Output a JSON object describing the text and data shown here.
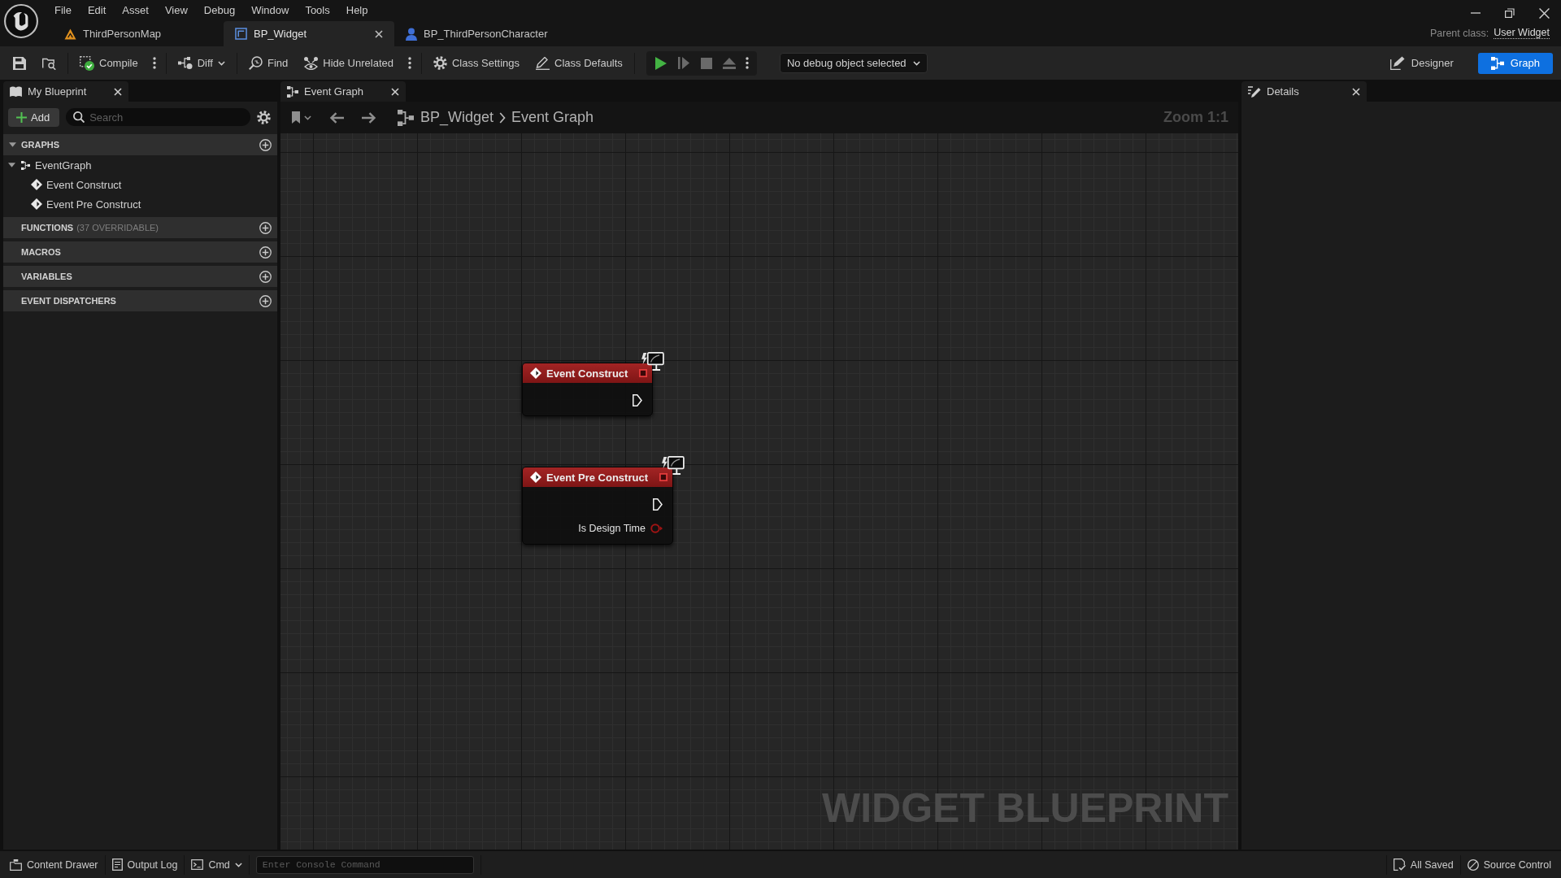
{
  "window": {
    "menu": [
      "File",
      "Edit",
      "Asset",
      "View",
      "Debug",
      "Window",
      "Tools",
      "Help"
    ],
    "parent_class_label": "Parent class:",
    "parent_class": "User Widget"
  },
  "document_tabs": [
    {
      "kind": "level",
      "label": "ThirdPersonMap",
      "selected": false
    },
    {
      "kind": "widget",
      "label": "BP_Widget",
      "selected": true
    },
    {
      "kind": "character",
      "label": "BP_ThirdPersonCharacter",
      "selected": false
    }
  ],
  "toolbar": {
    "groups": [
      [
        {
          "kind": "save"
        },
        {
          "kind": "browse"
        }
      ],
      [
        {
          "kind": "compile",
          "label": "Compile"
        },
        {
          "kind": "more"
        }
      ],
      [
        {
          "kind": "diff",
          "label": "Diff"
        }
      ],
      [
        {
          "kind": "find",
          "label": "Find"
        },
        {
          "kind": "hide_unrelated",
          "label": "Hide Unrelated"
        },
        {
          "kind": "more"
        }
      ],
      [
        {
          "kind": "class_settings",
          "label": "Class Settings"
        },
        {
          "kind": "class_defaults",
          "label": "Class Defaults"
        }
      ]
    ],
    "play_controls": [
      {
        "kind": "play",
        "disabled": false
      },
      {
        "kind": "step",
        "disabled": true
      },
      {
        "kind": "stop",
        "disabled": true
      },
      {
        "kind": "eject",
        "disabled": true
      },
      {
        "kind": "more",
        "disabled": false
      }
    ],
    "debug_selector": {
      "value": "No debug object selected"
    },
    "modes": [
      {
        "kind": "designer",
        "label": "Designer",
        "selected": false
      },
      {
        "kind": "graph",
        "label": "Graph",
        "selected": true
      }
    ]
  },
  "my_blueprint": {
    "tab": "My Blueprint",
    "add_button": "Add",
    "search": {
      "placeholder": "Search"
    },
    "sections": [
      {
        "title": "GRAPHS",
        "expanded": true,
        "items": [
          {
            "kind": "graph",
            "label": "EventGraph",
            "expanded": true,
            "children": [
              {
                "kind": "event",
                "label": "Event Construct"
              },
              {
                "kind": "event",
                "label": "Event Pre Construct"
              }
            ]
          }
        ]
      },
      {
        "title": "FUNCTIONS",
        "note": "(37 OVERRIDABLE)"
      },
      {
        "title": "MACROS"
      },
      {
        "title": "VARIABLES"
      },
      {
        "title": "EVENT DISPATCHERS"
      }
    ]
  },
  "event_graph": {
    "tab": "Event Graph",
    "breadcrumb": [
      "BP_Widget",
      "Event Graph"
    ],
    "zoom": "Zoom 1:1",
    "nodes": [
      {
        "title": "Event Construct",
        "pins": [
          {
            "kind": "exec"
          }
        ]
      },
      {
        "title": "Event Pre Construct",
        "pins": [
          {
            "kind": "exec"
          },
          {
            "kind": "bool",
            "label": "Is Design Time"
          }
        ]
      }
    ],
    "corner_text": "WIDGET BLUEPRINT"
  },
  "details": {
    "tab": "Details"
  },
  "status_bar": {
    "buttons": [
      {
        "kind": "content_drawer",
        "label": "Content Drawer"
      },
      {
        "kind": "output_log",
        "label": "Output Log"
      },
      {
        "kind": "cmd",
        "label": "Cmd"
      }
    ],
    "console": {
      "placeholder": "Enter Console Command"
    },
    "indicators": [
      {
        "kind": "saved",
        "label": "All Saved"
      },
      {
        "kind": "source_control",
        "label": "Source Control"
      }
    ]
  }
}
